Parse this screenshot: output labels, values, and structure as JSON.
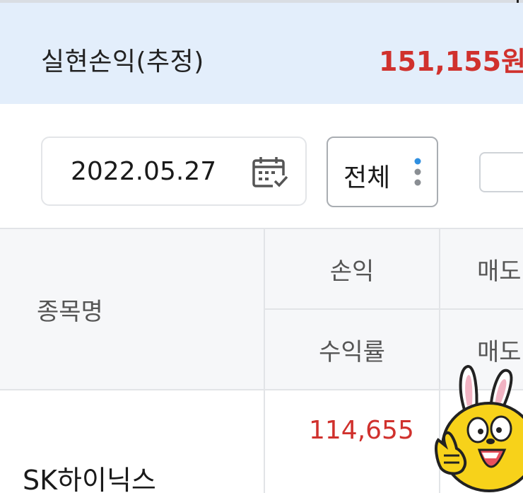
{
  "summary": {
    "label": "실현손익(추정)",
    "value": "151,155원"
  },
  "filters": {
    "date": "2022.05.27",
    "category": "전체"
  },
  "table": {
    "headers": {
      "stock_name": "종목명",
      "pnl": "손익",
      "return_rate": "수익률",
      "sell_1": "매도",
      "sell_2": "매도"
    },
    "rows": [
      {
        "stock_name": "SK하이닉스",
        "pnl": "114,655"
      }
    ]
  },
  "colors": {
    "summary_bg": "#e3eefb",
    "profit_red": "#d0312d",
    "header_bg": "#f6f7f9",
    "accent_blue": "#2f8fe0"
  },
  "icons": {
    "calendar": "calendar-icon",
    "more": "kebab-icon",
    "mascot": "rabbit-mascot-icon"
  }
}
